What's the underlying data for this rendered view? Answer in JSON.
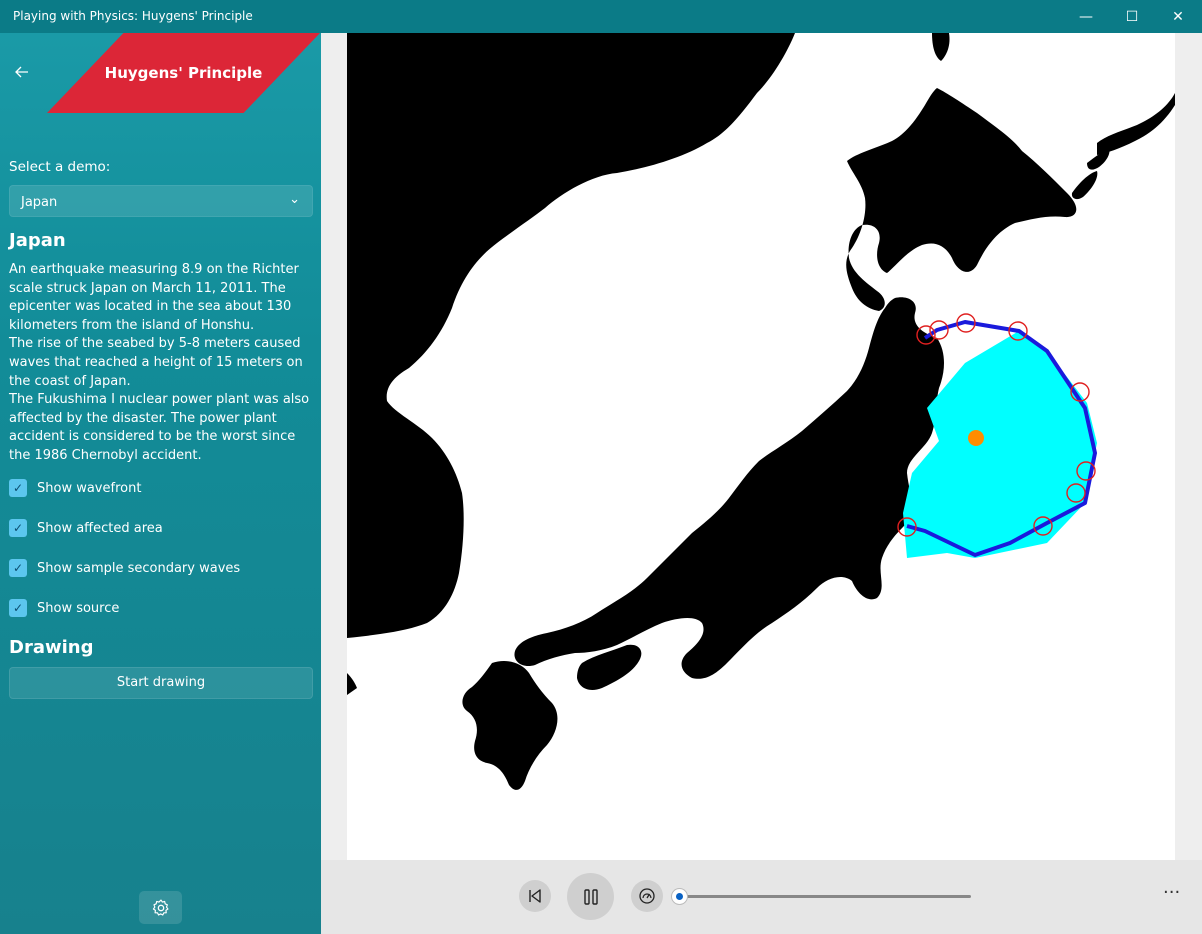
{
  "window": {
    "title": "Playing with Physics: Huygens' Principle",
    "controls": {
      "minimize": "—",
      "maximize": "☐",
      "close": "✕"
    }
  },
  "sidebar": {
    "back_icon": "arrow-left-icon",
    "banner_title": "Huygens' Principle",
    "select_label": "Select a demo:",
    "demo_selected": "Japan",
    "demo_heading": "Japan",
    "description": [
      "An earthquake measuring 8.9 on the Richter scale struck Japan on March 11, 2011. The epicenter was located in the sea about 130 kilometers from the island of Honshu.",
      "The rise of the seabed by 5-8 meters caused waves that reached a height of 15 meters on the coast of Japan.",
      "The Fukushima I nuclear power plant was also affected by the disaster. The power plant accident is considered to be the worst since the 1986 Chernobyl accident."
    ],
    "checkboxes": [
      {
        "label": "Show wavefront",
        "checked": true
      },
      {
        "label": "Show affected area",
        "checked": true
      },
      {
        "label": "Show sample secondary waves",
        "checked": true
      },
      {
        "label": "Show source",
        "checked": true
      }
    ],
    "drawing_heading": "Drawing",
    "drawing_button": "Start drawing",
    "settings_icon": "gear-icon"
  },
  "colors": {
    "titlebar": "#0b7b87",
    "sidebar": "#168e9a",
    "banner": "#dc2637",
    "checkbox": "#5cc6ee",
    "land": "#000000",
    "affected_area": "#00ffff",
    "wavefront": "#1a1adc",
    "secondary_wave": "#e02020",
    "source": "#ff8c00"
  },
  "playback": {
    "rewind_icon": "skip-back-icon",
    "pause_icon": "pause-icon",
    "speed_icon": "speedometer-icon",
    "progress": 0.0,
    "more_icon": "more-horizontal-icon"
  }
}
